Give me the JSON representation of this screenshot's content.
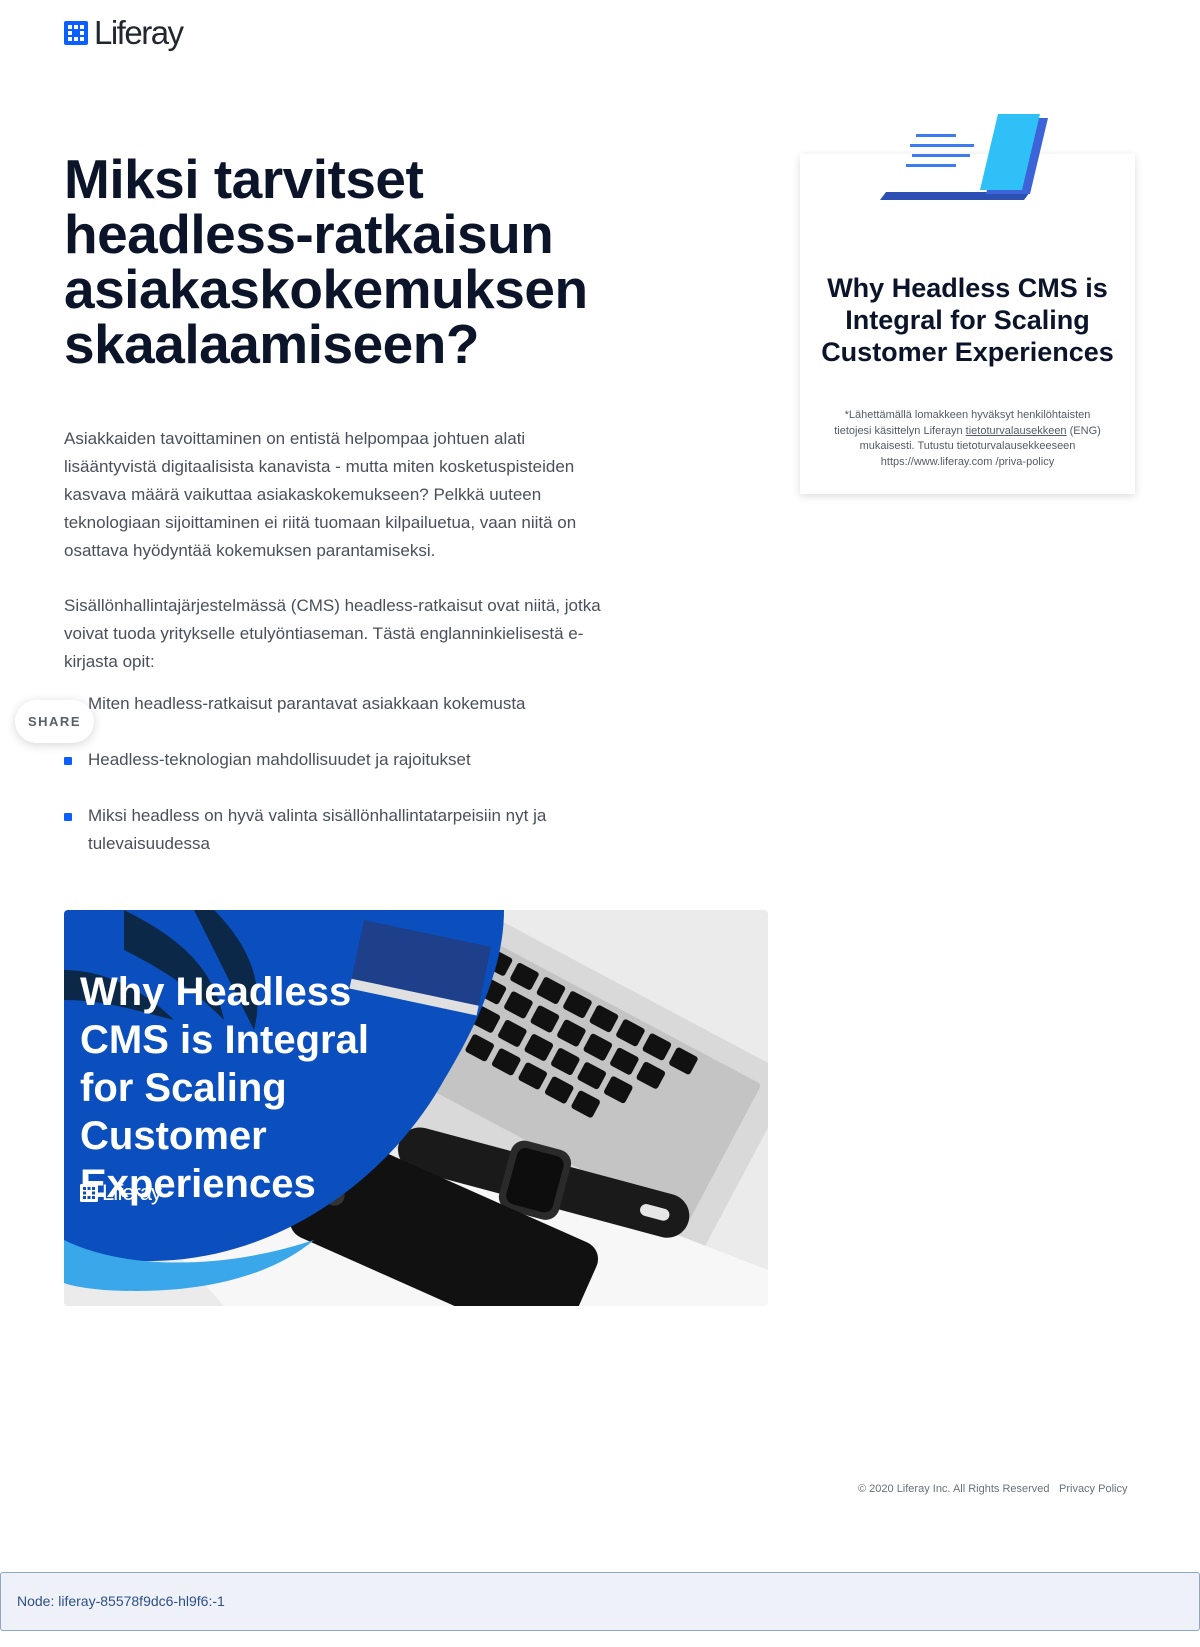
{
  "brand": {
    "name": "Liferay",
    "accent": "#0b5fff"
  },
  "header": {
    "logo_text": "Liferay"
  },
  "main": {
    "title": "Miksi tarvitset headless-ratkaisun asiakaskokemuksen skaalaamiseen?",
    "intro": "Asiakkaiden tavoittaminen on entistä helpompaa johtuen alati lisääntyvistä digitaalisista kanavista - mutta miten kosketuspisteiden kasvava määrä vaikuttaa asiakaskokemukseen? Pelkkä uuteen teknologiaan sijoittaminen ei riitä tuomaan kilpailuetua, vaan niitä on osattava hyödyntää kokemuksen parantamiseksi.",
    "lead": "Sisällönhallintajärjestelmässä (CMS) headless-ratkaisut ovat niitä, jotka voivat tuoda yritykselle etulyöntiaseman. Tästä englanninkielisestä e-kirjasta opit:",
    "bullets": [
      "Miten headless-ratkaisut parantavat asiakkaan kokemusta",
      "Headless-teknologian mahdollisuudet ja rajoitukset",
      "Miksi headless on hyvä valinta sisällönhallintatarpeisiin nyt ja tulevaisuudessa"
    ]
  },
  "share": {
    "label": "SHARE"
  },
  "hero": {
    "title": "Why Headless CMS is Integral for Scaling Customer Experiences",
    "logo_text": "Liferay"
  },
  "card": {
    "title": "Why Headless CMS is Integral for Scaling Customer Experiences",
    "fine_print_before": "*Lähettämällä lomakkeen  hyväksyt henkilöhtaisten tietojesi käsittelyn Liferayn ",
    "fine_print_link": "tietoturvalausekkeen",
    "fine_print_after": " (ENG) mukaisesti. Tutustu tietoturvalausekkeeseen https://www.liferay.com /priva-policy"
  },
  "footer": {
    "copyright": "© 2020 Liferay Inc. All Rights Reserved",
    "privacy_link": "Privacy Policy"
  },
  "node_bar": {
    "text": "Node: liferay-85578f9dc6-hl9f6:-1"
  }
}
